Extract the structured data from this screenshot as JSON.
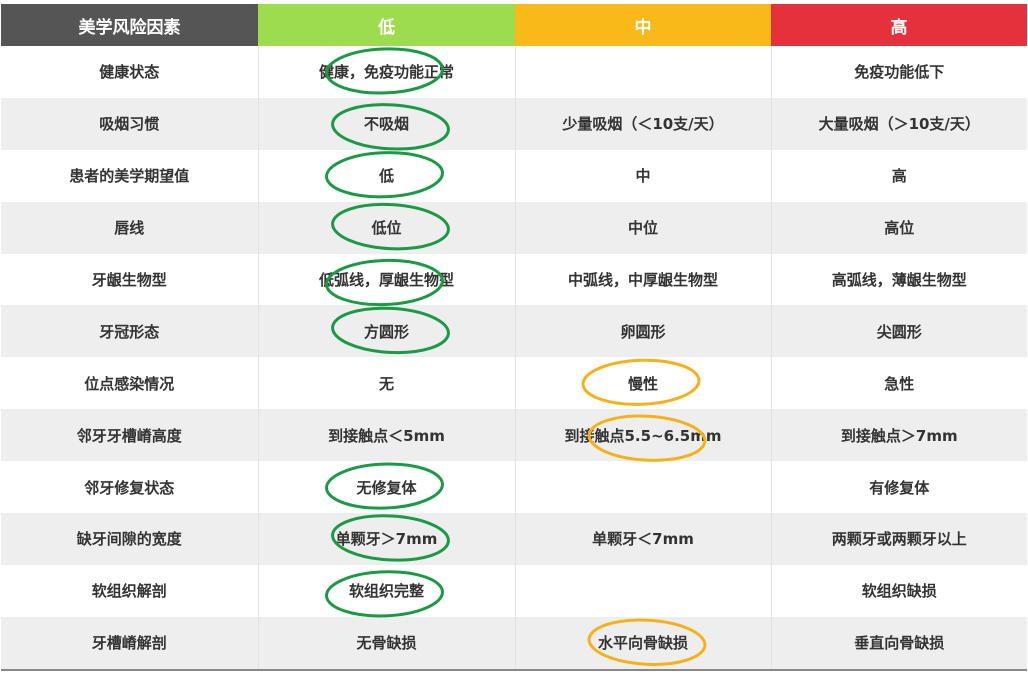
{
  "colors": {
    "header_factor": "#555555",
    "header_low": "#9ddc4f",
    "header_mid": "#f9b919",
    "header_high": "#e4313b",
    "circle_low": "#1a9a45",
    "circle_mid": "#f5b119"
  },
  "header": {
    "factor": "美学风险因素",
    "low": "低",
    "mid": "中",
    "high": "高"
  },
  "rows": [
    {
      "factor": "健康状态",
      "low": "健康，免疫功能正常",
      "mid": "",
      "high": "免疫功能低下"
    },
    {
      "factor": "吸烟习惯",
      "low": "不吸烟",
      "mid": "少量吸烟（＜10支/天）",
      "high": "大量吸烟（＞10支/天）"
    },
    {
      "factor": "患者的美学期望值",
      "low": "低",
      "mid": "中",
      "high": "高"
    },
    {
      "factor": "唇线",
      "low": "低位",
      "mid": "中位",
      "high": "高位"
    },
    {
      "factor": "牙龈生物型",
      "low": "低弧线，厚龈生物型",
      "mid": "中弧线，中厚龈生物型",
      "high": "高弧线，薄龈生物型"
    },
    {
      "factor": "牙冠形态",
      "low": "方圆形",
      "mid": "卵圆形",
      "high": "尖圆形"
    },
    {
      "factor": "位点感染情况",
      "low": "无",
      "mid": "慢性",
      "high": "急性"
    },
    {
      "factor": "邻牙牙槽嵴高度",
      "low": "到接触点＜5mm",
      "mid": "到接触点5.5~6.5mm",
      "high": "到接触点＞7mm"
    },
    {
      "factor": "邻牙修复状态",
      "low": "无修复体",
      "mid": "",
      "high": "有修复体"
    },
    {
      "factor": "缺牙间隙的宽度",
      "low": "单颗牙＞7mm",
      "mid": "单颗牙＜7mm",
      "high": "两颗牙或两颗牙以上"
    },
    {
      "factor": "软组织解剖",
      "low": "软组织完整",
      "mid": "",
      "high": "软组织缺损"
    },
    {
      "factor": "牙槽嵴解剖",
      "low": "无骨缺损",
      "mid": "水平向骨缺损",
      "high": "垂直向骨缺损"
    }
  ],
  "selections": [
    {
      "row": 0,
      "level": "low"
    },
    {
      "row": 1,
      "level": "low"
    },
    {
      "row": 2,
      "level": "low"
    },
    {
      "row": 3,
      "level": "low"
    },
    {
      "row": 4,
      "level": "low"
    },
    {
      "row": 5,
      "level": "low"
    },
    {
      "row": 6,
      "level": "mid"
    },
    {
      "row": 7,
      "level": "mid"
    },
    {
      "row": 8,
      "level": "low"
    },
    {
      "row": 9,
      "level": "low"
    },
    {
      "row": 10,
      "level": "low"
    },
    {
      "row": 11,
      "level": "mid"
    }
  ]
}
